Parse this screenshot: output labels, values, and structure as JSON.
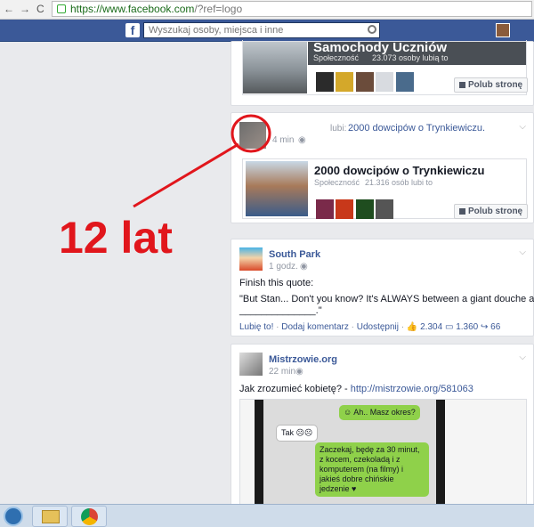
{
  "browser": {
    "back": "←",
    "forward": "→",
    "reload": "C",
    "url_host": "https://www.facebook.com",
    "url_path": "/?ref=logo"
  },
  "fb": {
    "logo": "f",
    "search_placeholder": "Wyszukaj osoby, miejsca i inne"
  },
  "post1": {
    "page_name": "Samochody Uczniów",
    "page_type": "Społeczność",
    "page_stats": "23.073 osoby lubią to",
    "like_button": "Polub stronę"
  },
  "post2": {
    "time": "4 min",
    "liked_prefix": "lubi:",
    "liked_page": "2000 dowcipów o Trynkiewiczu.",
    "page_name": "2000 dowcipów o Trynkiewiczu",
    "page_type": "Społeczność",
    "page_stats": "21.316 osób lubi to",
    "like_button": "Polub stronę"
  },
  "annotation": {
    "text": "12 lat",
    "color": "#e1161c"
  },
  "post3": {
    "author": "South Park",
    "time": "1 godz.",
    "text_line1": "Finish this quote:",
    "text_line2": "\"But Stan... Don't you know? It's ALWAYS between a giant douche and",
    "text_line3": "______________.\"",
    "like": "Lubię to!",
    "comment": "Dodaj komentarz",
    "share": "Udostępnij",
    "likes_count": "2.304",
    "comments_count": "1.360",
    "shares_count": "66"
  },
  "post4": {
    "author": "Mistrzowie.org",
    "time": "22 min",
    "text": "Jak zrozumieć kobietę? - ",
    "link": "http://mistrzowie.org/581063",
    "chat": {
      "msg1": "Ah.. Masz okres?",
      "msg2": "Tak",
      "msg3": "Zaczekaj, będę za 30 minut, z kocem, czekoladą i z komputerem (na filmy) i jakieś dobre chińskie jedzenie"
    }
  },
  "colors": {
    "facebook_blue": "#3b5998",
    "red_marker": "#e1161c"
  }
}
